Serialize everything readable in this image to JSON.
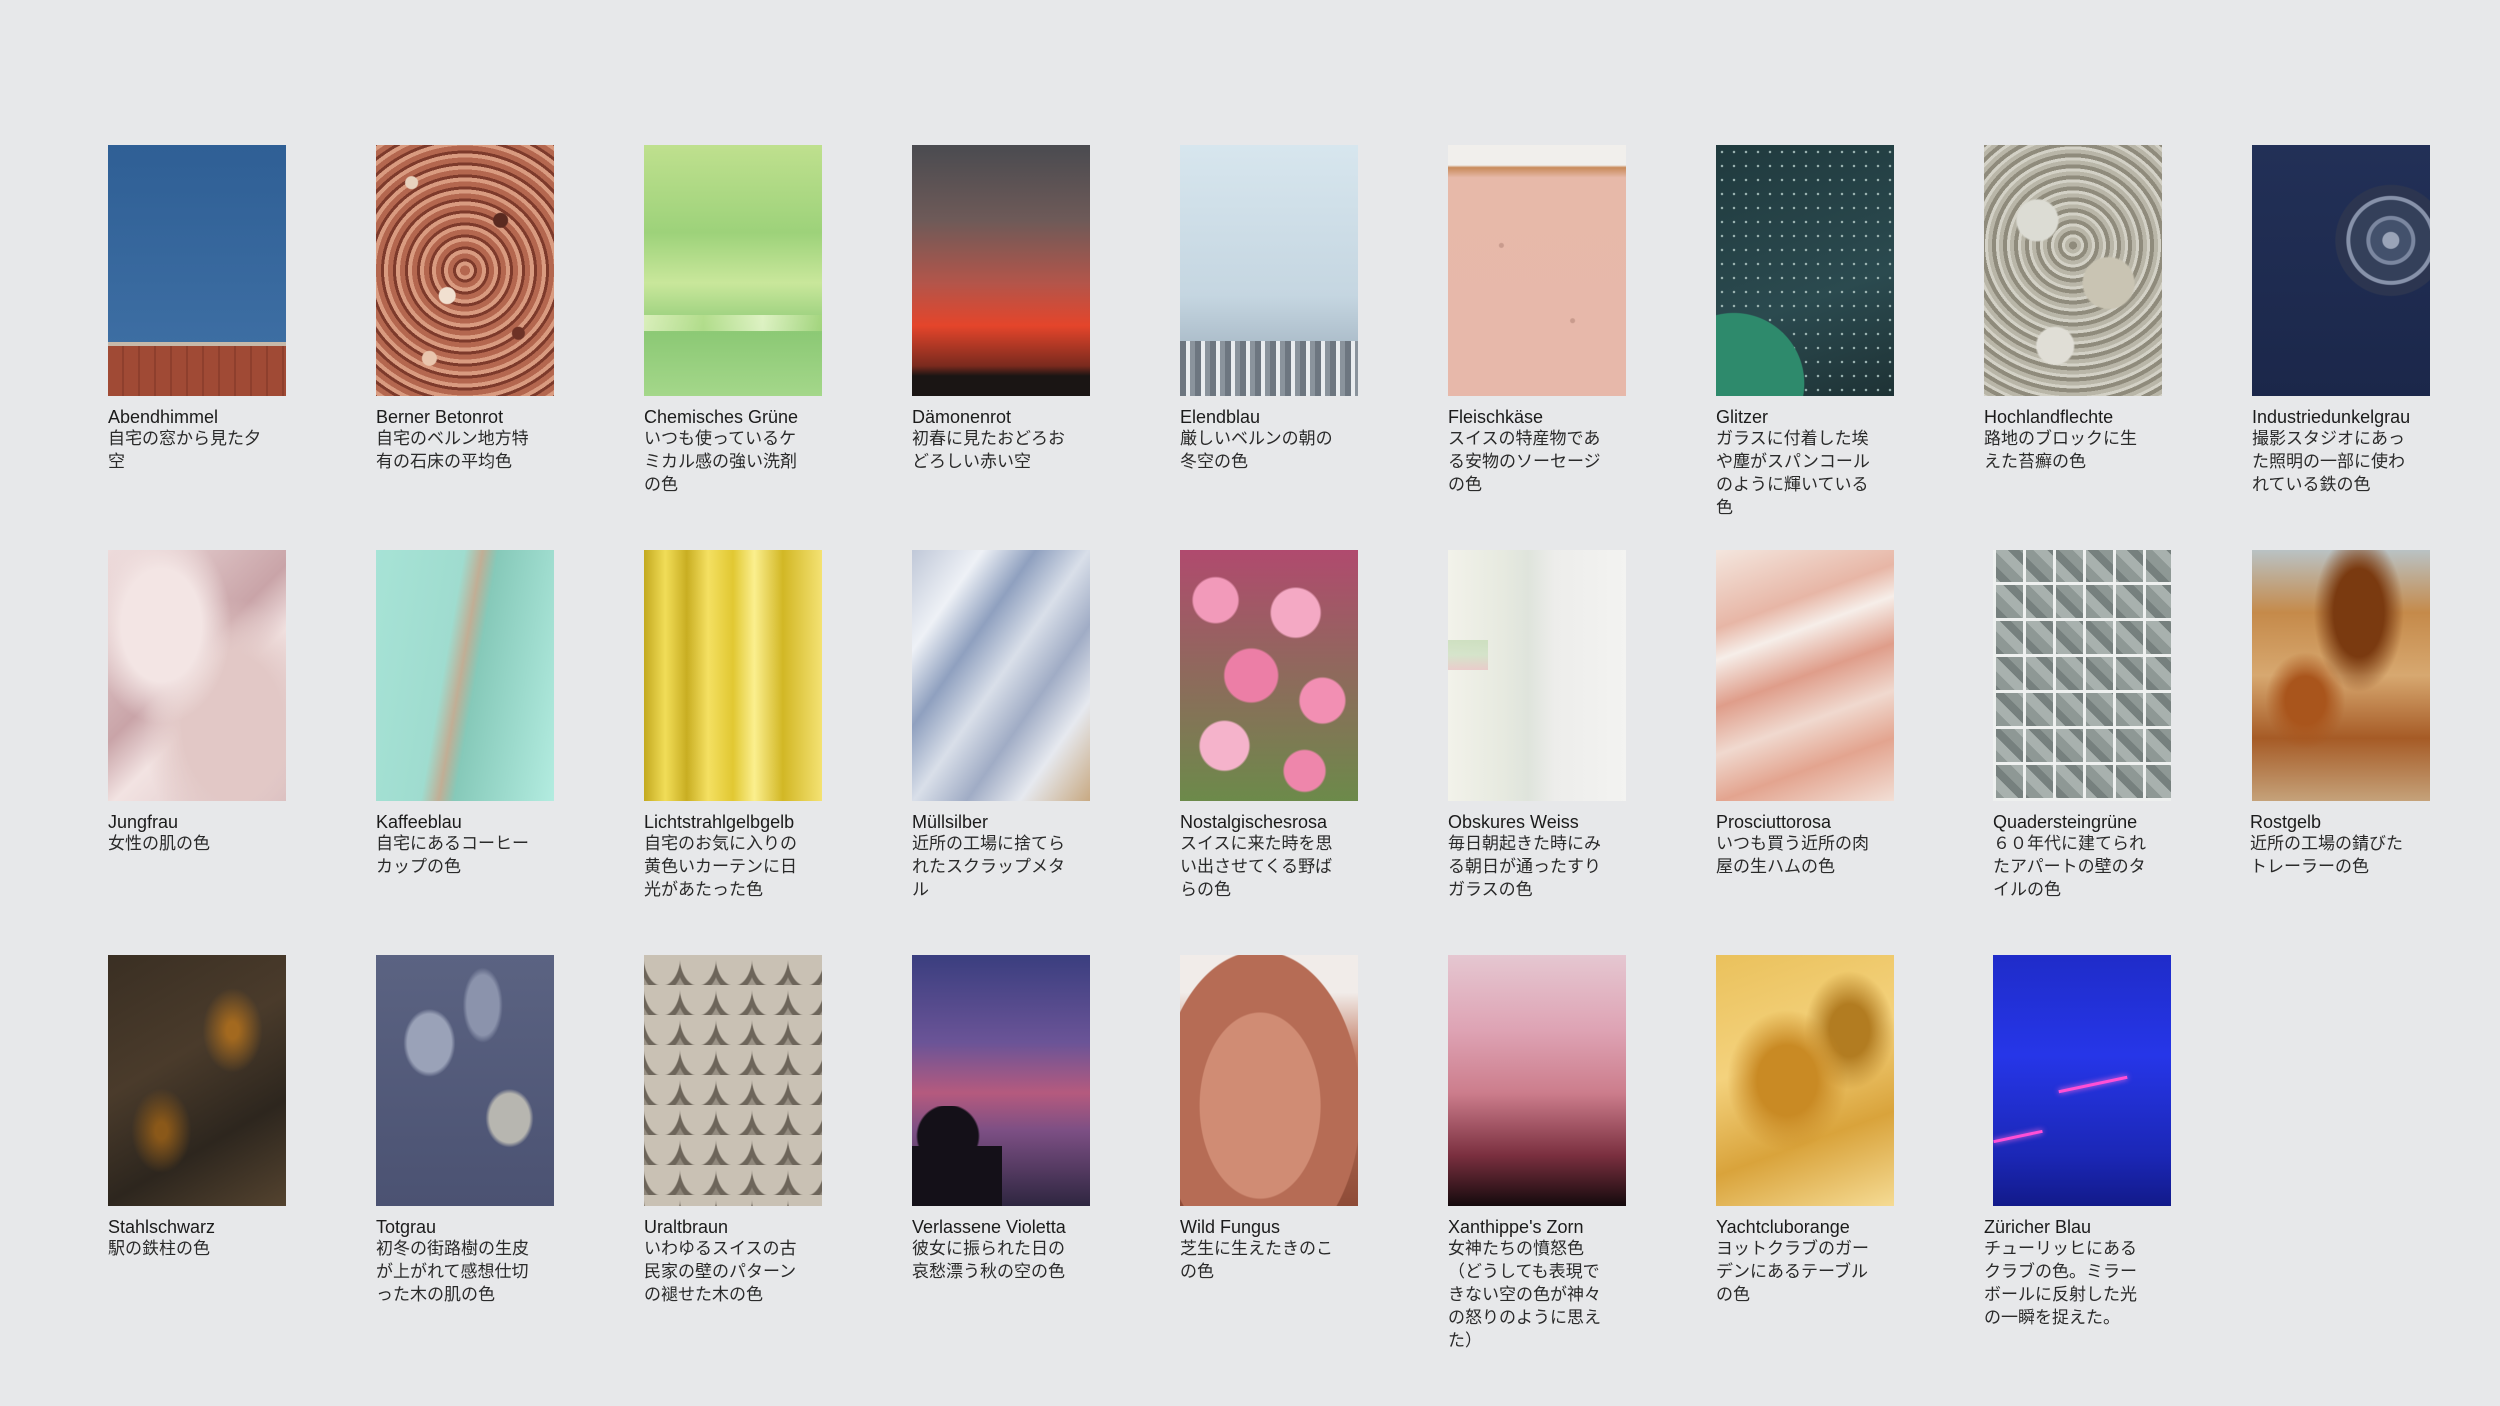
{
  "swatches": [
    {
      "name": "Abendhimmel",
      "desc": "自宅の窓から見た夕空"
    },
    {
      "name": "Berner Betonrot",
      "desc": "自宅のベルン地方特有の石床の平均色"
    },
    {
      "name": "Chemisches Grüne",
      "desc": "いつも使っているケミカル感の強い洗剤の色"
    },
    {
      "name": "Dämonenrot",
      "desc": "初春に見たおどろおどろしい赤い空"
    },
    {
      "name": "Elendblau",
      "desc": "厳しいベルンの朝の冬空の色"
    },
    {
      "name": "Fleischkäse",
      "desc": "スイスの特産物である安物のソーセージの色"
    },
    {
      "name": "Glitzer",
      "desc": "ガラスに付着した埃や塵がスパンコールのように輝いている色"
    },
    {
      "name": "Hochlandflechte",
      "desc": "路地のブロックに生えた苔癬の色"
    },
    {
      "name": "Industriedunkelgrau",
      "desc": "撮影スタジオにあった照明の一部に使われている鉄の色"
    },
    {
      "name": "Jungfrau",
      "desc": "女性の肌の色"
    },
    {
      "name": "Kaffeeblau",
      "desc": "自宅にあるコーヒーカップの色"
    },
    {
      "name": "Lichtstrahlgelbgelb",
      "desc": "自宅のお気に入りの黄色いカーテンに日光があたった色"
    },
    {
      "name": "Müllsilber",
      "desc": "近所の工場に捨てられたスクラップメタル"
    },
    {
      "name": "Nostalgischesrosa",
      "desc": "スイスに来た時を思い出させてくる野ばらの色"
    },
    {
      "name": "Obskures Weiss",
      "desc": "毎日朝起きた時にみる朝日が通ったすりガラスの色"
    },
    {
      "name": "Prosciuttorosa",
      "desc": "いつも買う近所の肉屋の生ハムの色"
    },
    {
      "name": "Quadersteingrüne",
      "desc": "６０年代に建てられたアパートの壁のタイルの色"
    },
    {
      "name": "Rostgelb",
      "desc": "近所の工場の錆びたトレーラーの色"
    },
    {
      "name": "Stahlschwarz",
      "desc": "駅の鉄柱の色"
    },
    {
      "name": "Totgrau",
      "desc": "初冬の街路樹の生皮が上がれて感想仕切った木の肌の色"
    },
    {
      "name": "Uraltbraun",
      "desc": "いわゆるスイスの古民家の壁のパターンの褪せた木の色"
    },
    {
      "name": "Verlassene Violetta",
      "desc": "彼女に振られた日の哀愁漂う秋の空の色"
    },
    {
      "name": "Wild Fungus",
      "desc": "芝生に生えたきのこの色"
    },
    {
      "name": "Xanthippe's Zorn",
      "desc": "女神たちの憤怒色（どうしても表現できない空の色が神々の怒りのように思えた）"
    },
    {
      "name": "Yachtcluborange",
      "desc": "ヨットクラブのガーデンにあるテーブルの色"
    },
    {
      "name": "Züricher Blau",
      "desc": "チューリッヒにあるクラブの色。ミラーボールに反射した光の一瞬を捉えた。"
    }
  ]
}
